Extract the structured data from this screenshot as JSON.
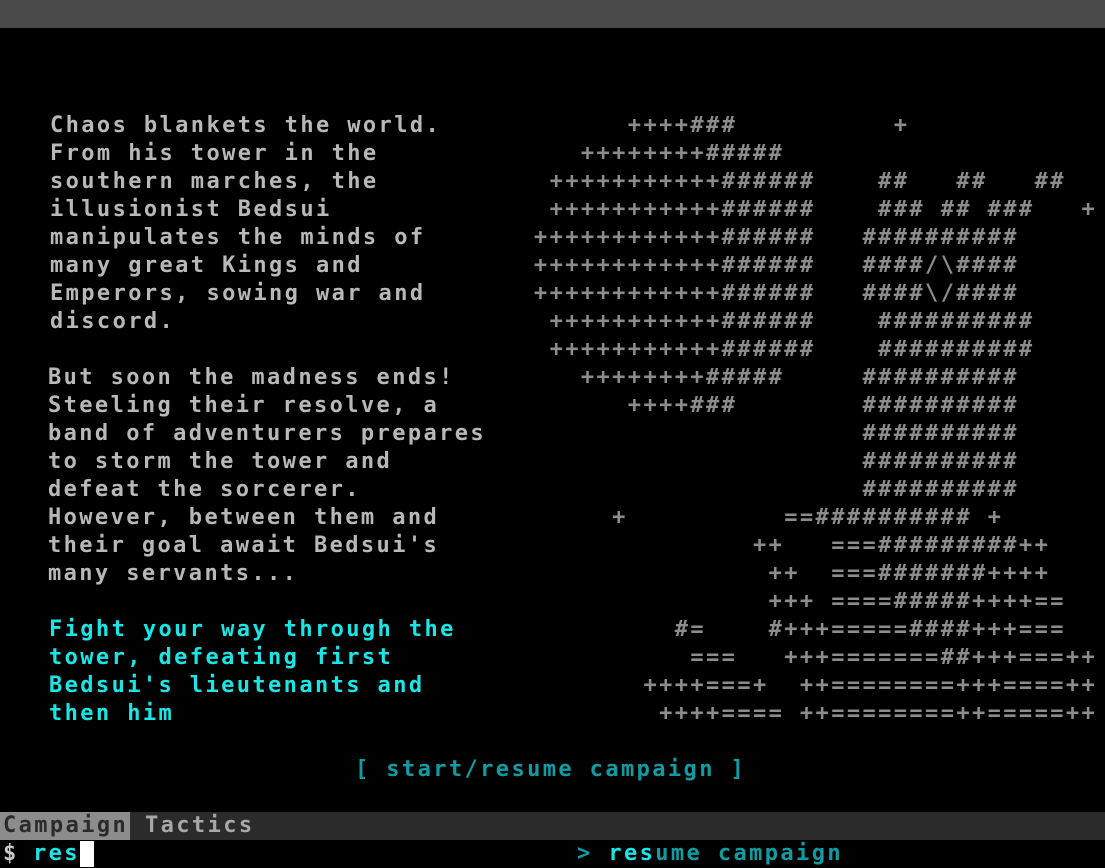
{
  "story_lines": [
    "Chaos blankets the world.",
    "From his tower in the",
    "southern marches, the",
    "illusionist Bedsui",
    "manipulates the minds of",
    "many great Kings and",
    "Emperors, sowing war and",
    "discord.",
    "",
    "But soon the madness ends!",
    "Steeling their resolve, a",
    "band of adventurers prepares",
    "to storm the tower and",
    "defeat the sorcerer.",
    "However, between them and",
    "their goal await Bedsui's",
    "many servants..."
  ],
  "objective_lines": [
    "Fight your way through the",
    "tower, defeating first",
    "Bedsui's lieutenants and",
    "then him"
  ],
  "ascii_art": [
    "                                        ++++###          +",
    "                                     ++++++++#####",
    "                                   +++++++++++######    ##   ##   ##",
    "                                   +++++++++++######    ### ## ###   +",
    "                                  ++++++++++++######   ##########",
    "                                  ++++++++++++######   ####/\\####",
    "                                  ++++++++++++######   ####\\/####",
    "                                   +++++++++++######    ##########",
    "                                   +++++++++++######    ##########",
    "                                     ++++++++#####     ##########",
    "                                        ++++###        ##########",
    "                                                       ##########",
    "                                                       ##########",
    "                                                       ##########",
    "                                       +          ==########## +",
    "                                                ++   ===#########++",
    "                                                 ++  ===#######++++",
    "                                                 +++ ====#####++++==",
    "                                           #=    #+++=====####+++===",
    "                                            ===   +++=======##+++===++",
    "                                         ++++===+  ++========+++====++",
    "                                          ++++==== ++========++=====++"
  ],
  "menu": {
    "start_label": "[ start/resume campaign ]"
  },
  "tabs": {
    "active": "Campaign",
    "inactive": "Tactics"
  },
  "prompt": {
    "symbol": "$",
    "input_value": "res",
    "suggestion_arrow": ">",
    "suggestion_match": "res",
    "suggestion_rest": "ume campaign"
  },
  "colors": {
    "story_text": "#b8b8b8",
    "objective_text": "#19e6e6",
    "menu_text": "#0f9da3",
    "ascii_art": "#8c8c8c",
    "background": "#000000"
  }
}
